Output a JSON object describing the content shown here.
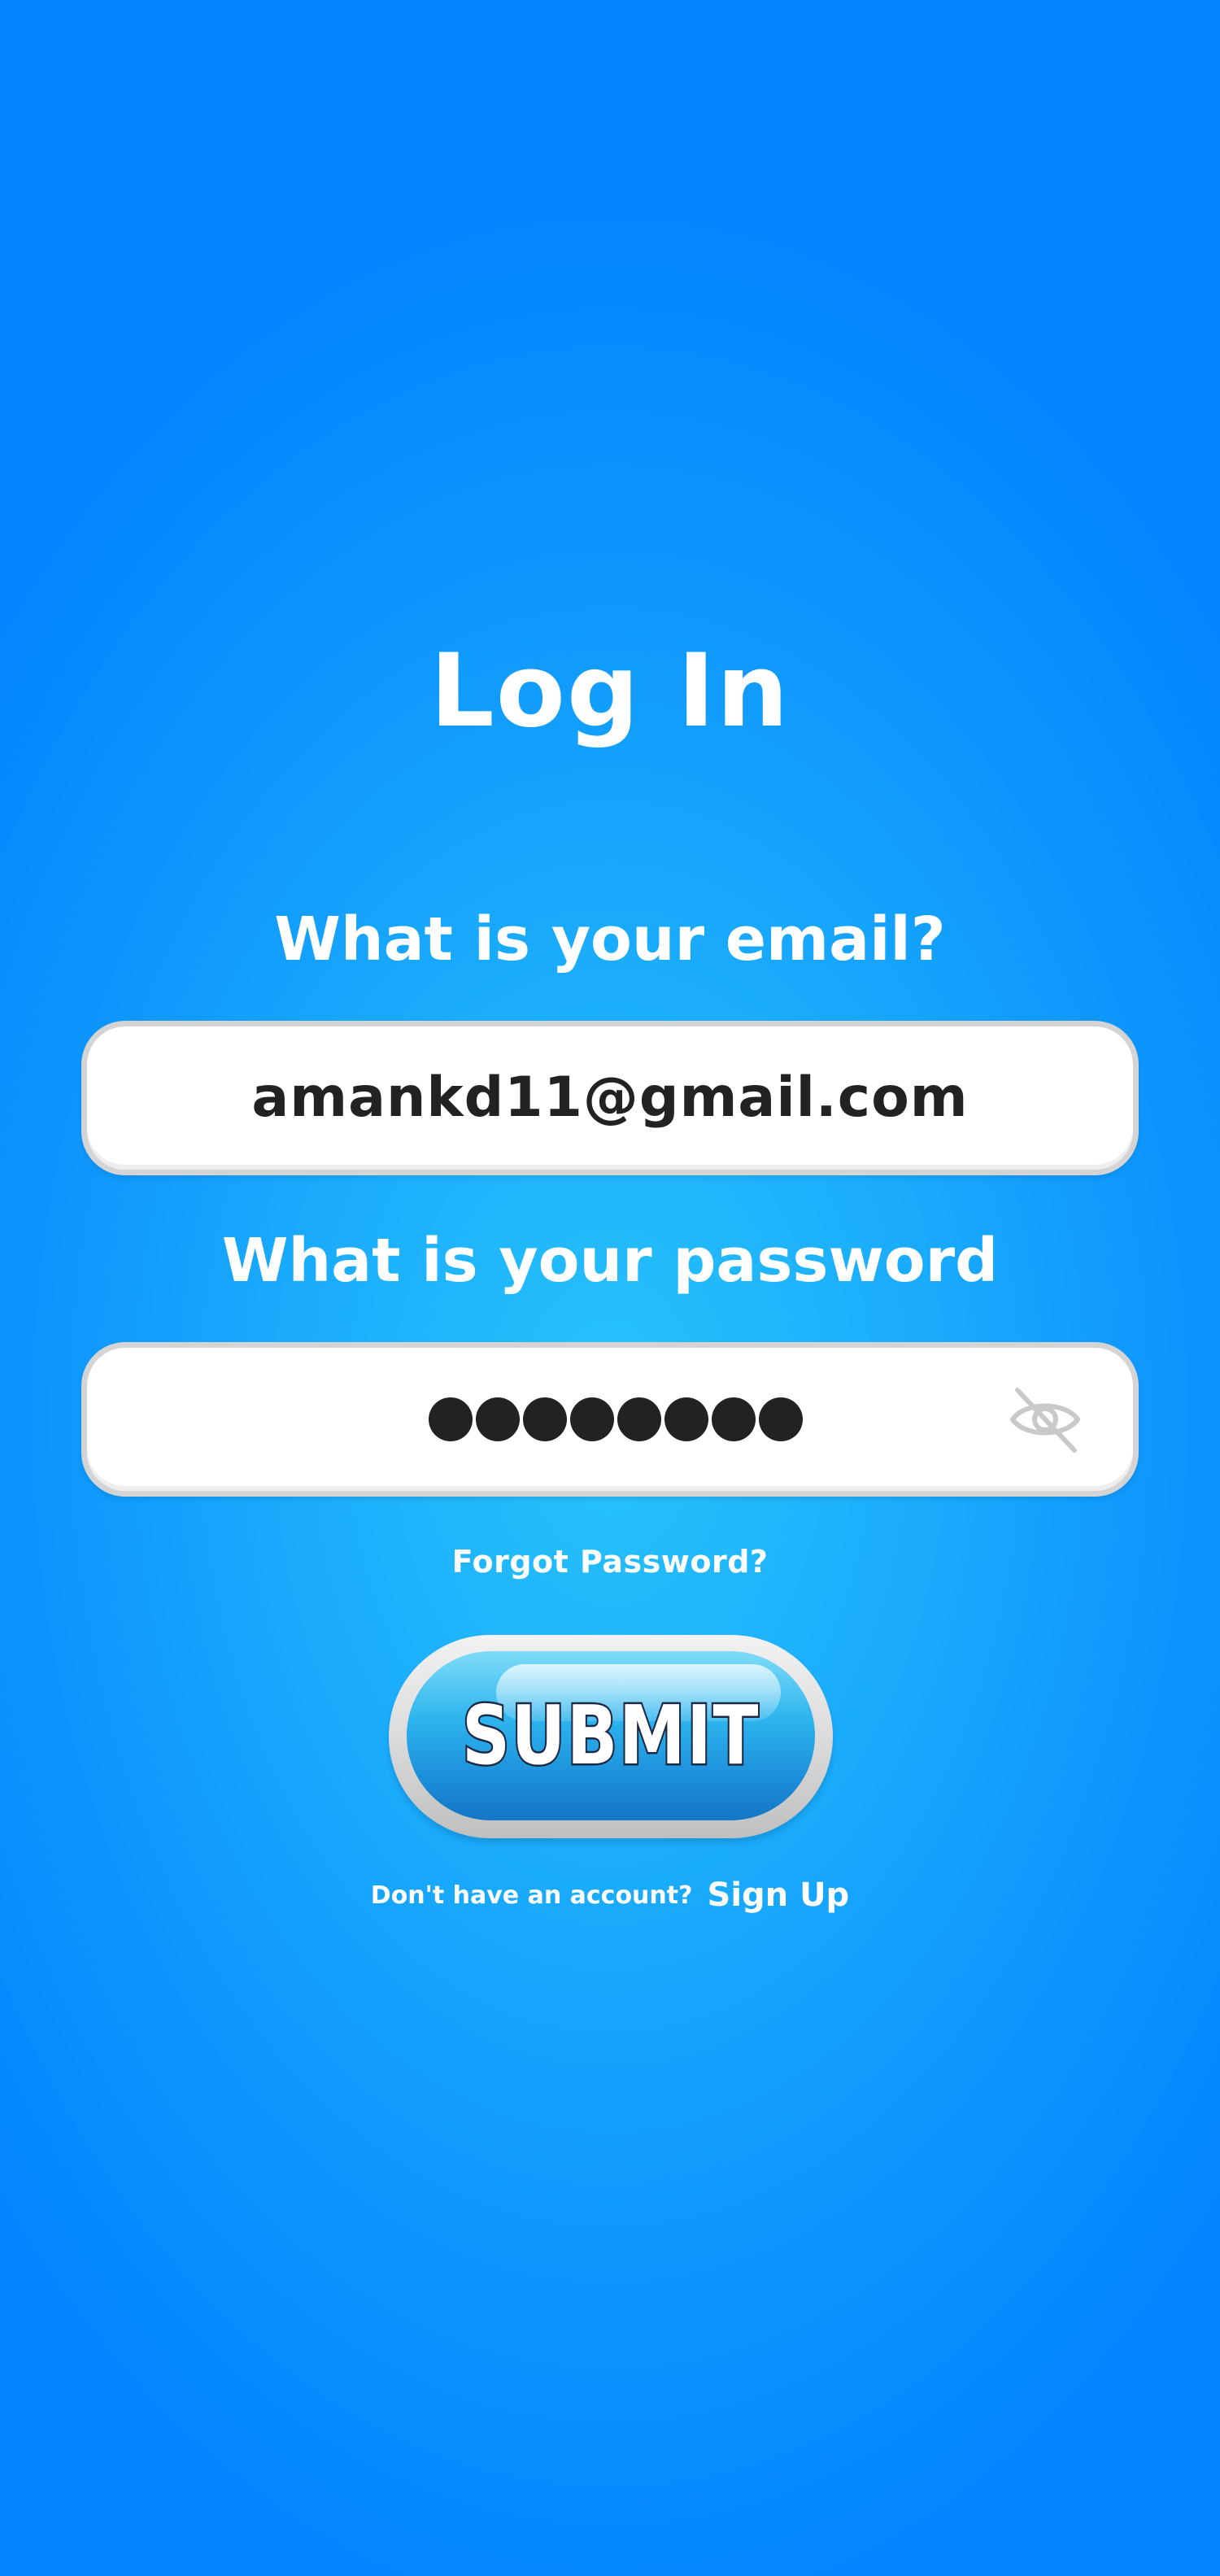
{
  "page": {
    "title": "Log In"
  },
  "email": {
    "label": "What is your email?",
    "value": "amankd11@gmail.com"
  },
  "password": {
    "label": "What is your password",
    "masked_length": 8,
    "toggle_icon": "eye-off-icon"
  },
  "links": {
    "forgot_password": "Forgot Password?",
    "no_account": "Don't have an account?",
    "sign_up": "Sign Up"
  },
  "submit": {
    "label": "SUBMIT"
  },
  "colors": {
    "background_top": "#0484ff",
    "background_center": "#28c2fc",
    "text": "#ffffff",
    "field_background": "#ffffff",
    "field_border": "#d4d4d4",
    "field_text": "#222222",
    "button_blue": "#2db4ee"
  }
}
